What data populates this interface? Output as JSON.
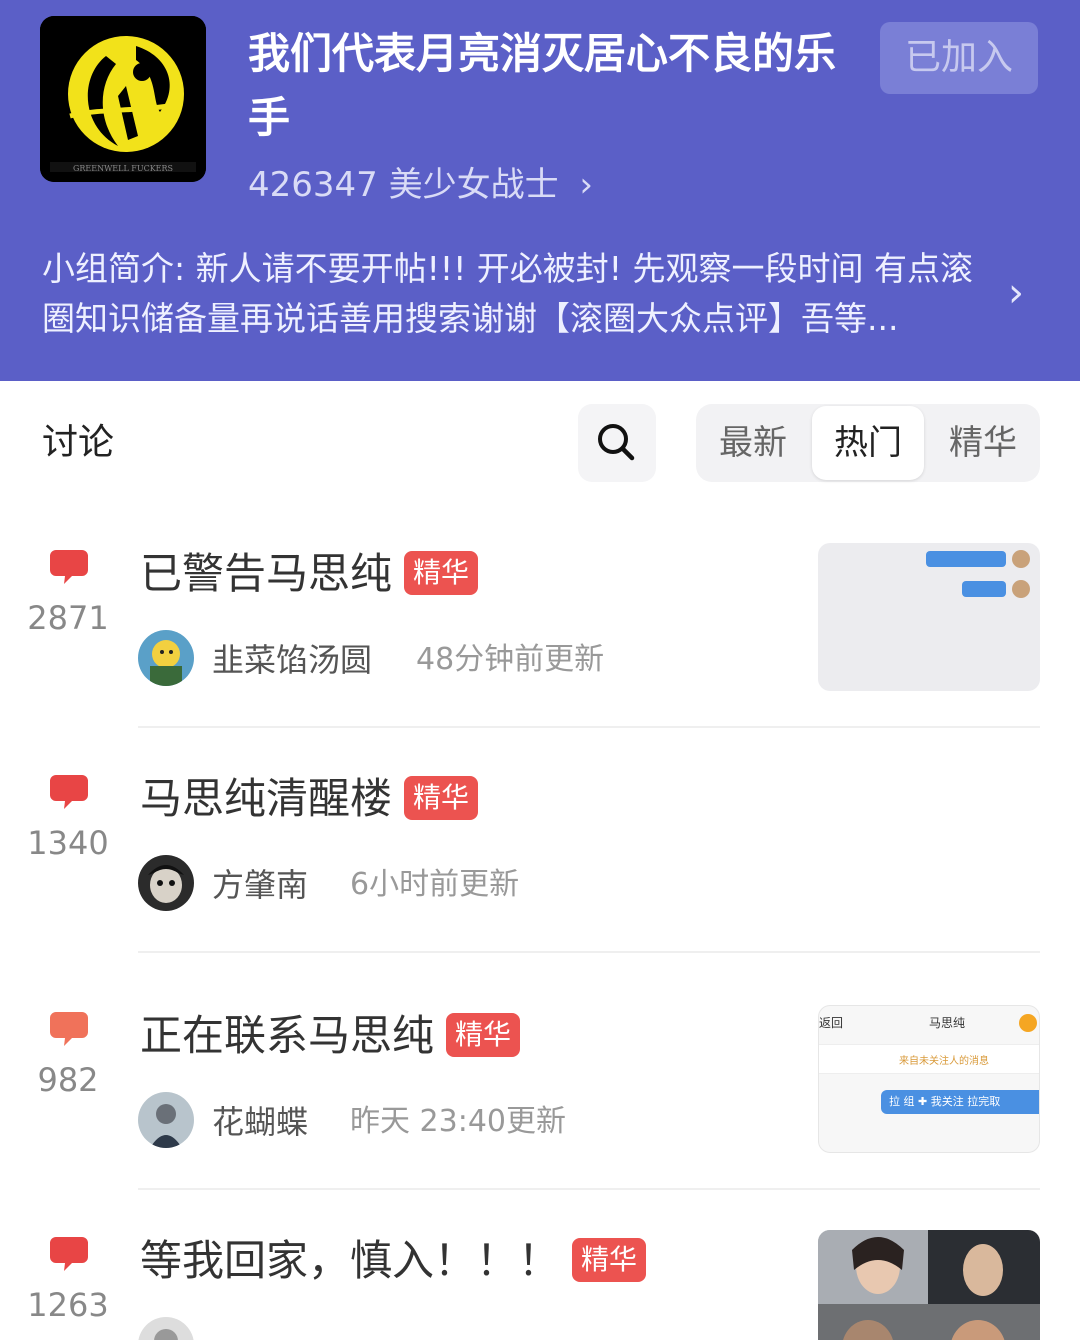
{
  "header": {
    "title": "我们代表月亮消灭居心不良的乐手",
    "join_label": "已加入",
    "member_count": "426347",
    "member_name": "美少女战士",
    "chevron": "›",
    "intro_text": "小组简介: 新人请不要开帖!!! 开必被封! 先观察一段时间 有点滚圈知识储备量再说话善用搜索谢谢【滚圈大众点评】吾等...",
    "logo_icon": "band-logo-icon",
    "colors": {
      "header_bg": "#5b5fc7",
      "tag_red": "#ec5350"
    }
  },
  "tabs_bar": {
    "section_label": "讨论",
    "search_icon": "search-icon",
    "sort_options": [
      "最新",
      "热门",
      "精华"
    ],
    "active_sort": "热门"
  },
  "posts": [
    {
      "count": "2871",
      "title": "已警告马思纯",
      "tag": "精华",
      "author": "韭菜馅汤圆",
      "time": "48分钟前更新",
      "has_thumb": true
    },
    {
      "count": "1340",
      "title": "马思纯清醒楼",
      "tag": "精华",
      "author": "方肇南",
      "time": "6小时前更新",
      "has_thumb": false
    },
    {
      "count": "982",
      "title": "正在联系马思纯",
      "tag": "精华",
      "author": "花蝴蝶",
      "time": "昨天 23:40更新",
      "has_thumb": true
    },
    {
      "count": "1263",
      "title": "等我回家，慎入！！！",
      "tag": "精华",
      "author": "",
      "time": "",
      "has_thumb": true
    }
  ],
  "thumb_text": {
    "chat_back": "返回",
    "chat_title": "马思纯",
    "chat_notice": "来自未关注人的消息",
    "chat_bar": "拉 组 ✚ 我关注 拉完取"
  }
}
